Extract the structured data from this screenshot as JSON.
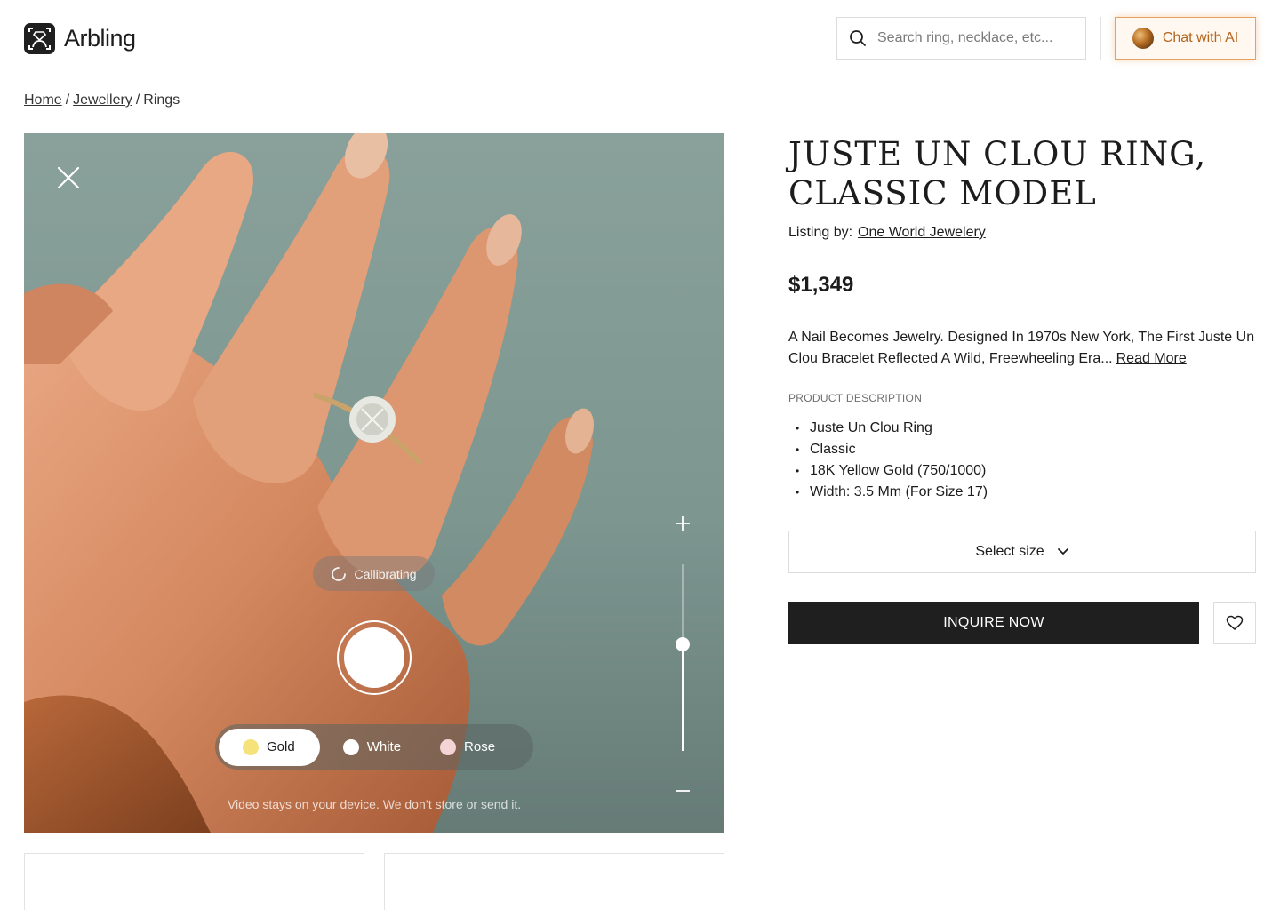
{
  "header": {
    "brand": "Arbling",
    "search_placeholder": "Search ring, necklace, etc...",
    "chat_label": "Chat with AI",
    "accent_color": "#b5651d"
  },
  "breadcrumb": {
    "home": "Home",
    "category": "Jewellery",
    "current": "Rings",
    "separator": "/"
  },
  "camera": {
    "calibrating_label": "Callibrating",
    "metal_options": [
      {
        "label": "Gold",
        "color": "#f5e27a",
        "selected": true
      },
      {
        "label": "White",
        "color": "#ffffff",
        "selected": false
      },
      {
        "label": "Rose",
        "color": "#f4d4d4",
        "selected": false
      }
    ],
    "disclaimer": "Video stays on your device. We don’t store or send it.",
    "zoom_level": 0.57
  },
  "product": {
    "title": "JUSTE UN CLOU RING, CLASSIC MODEL",
    "listing_prefix": "Listing by:",
    "seller": "One World Jewelery",
    "price": "$1,349",
    "description": "A Nail Becomes Jewelry. Designed In 1970s New York, The First Juste Un Clou Bracelet Reflected A Wild, Freewheeling Era...",
    "read_more": "Read More",
    "details_label": "PRODUCT DESCRIPTION",
    "details": [
      "Juste Un Clou Ring",
      "Classic",
      "18K Yellow Gold (750/1000)",
      "Width: 3.5 Mm (For Size 17)"
    ],
    "size_label": "Select size",
    "inquire_label": "INQUIRE NOW"
  }
}
